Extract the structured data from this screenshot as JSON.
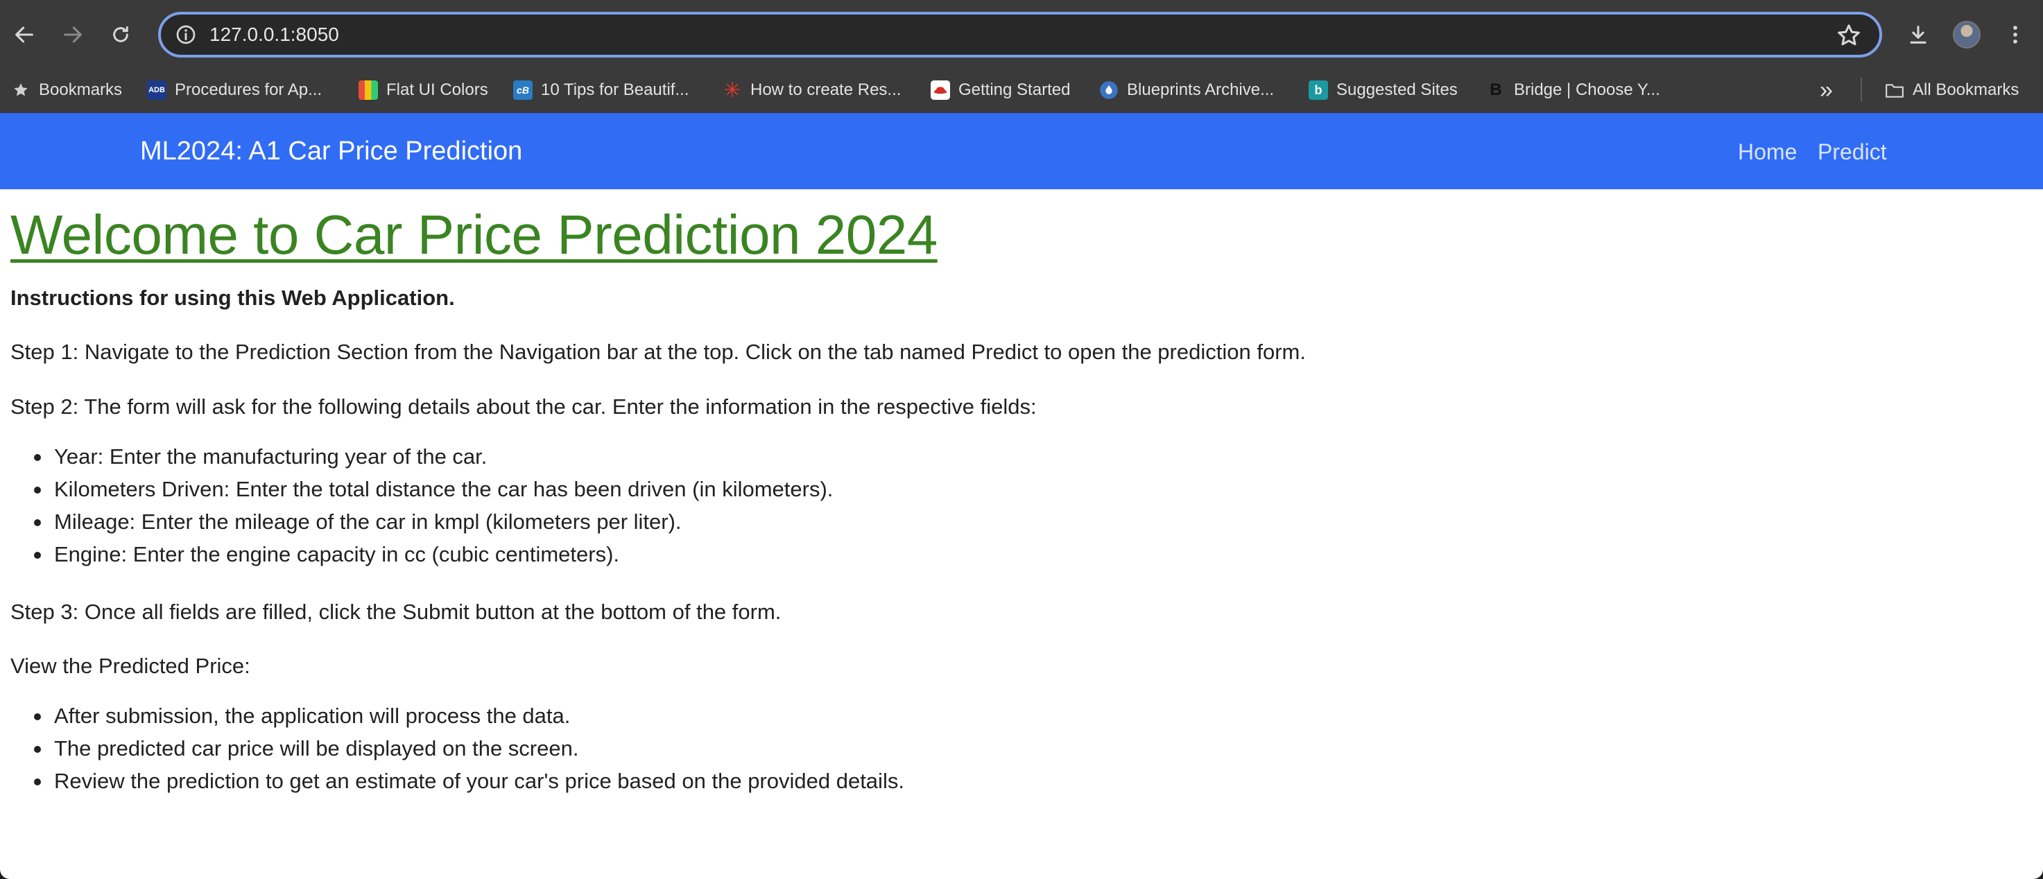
{
  "browser": {
    "url": "127.0.0.1:8050",
    "bookmarks": [
      {
        "label": "Bookmarks",
        "icon": "star-icon"
      },
      {
        "label": "Procedures for Ap...",
        "icon": "adb-icon",
        "badge": "ADB"
      },
      {
        "label": "Flat UI Colors",
        "icon": "flat-ui-colors-icon"
      },
      {
        "label": "10 Tips for Beautif...",
        "icon": "cb-icon",
        "badge": "cB"
      },
      {
        "label": "How to create Res...",
        "icon": "asterisk-icon"
      },
      {
        "label": "Getting Started",
        "icon": "redhat-icon"
      },
      {
        "label": "Blueprints Archive...",
        "icon": "drop-icon"
      },
      {
        "label": "Suggested Sites",
        "icon": "bing-icon",
        "badge": "b"
      },
      {
        "label": "Bridge | Choose Y...",
        "icon": "bridge-icon",
        "badge": "B"
      }
    ],
    "overflow_label": "»",
    "all_bookmarks_label": "All Bookmarks"
  },
  "navbar": {
    "brand": "ML2024: A1 Car Price Prediction",
    "links": [
      "Home",
      "Predict"
    ],
    "bg_color": "#316cf4"
  },
  "main": {
    "title": "Welcome to Car Price Prediction 2024",
    "title_color": "#3a8422",
    "instructions_heading": "Instructions for using this Web Application.",
    "step1": "Step 1: Navigate to the Prediction Section from the Navigation bar at the top. Click on the tab named Predict to open the prediction form.",
    "step2": "Step 2: The form will ask for the following details about the car. Enter the information in the respective fields:",
    "fields": [
      "Year: Enter the manufacturing year of the car.",
      "Kilometers Driven: Enter the total distance the car has been driven (in kilometers).",
      "Mileage: Enter the mileage of the car in kmpl (kilometers per liter).",
      "Engine: Enter the engine capacity in cc (cubic centimeters)."
    ],
    "step3": "Step 3: Once all fields are filled, click the Submit button at the bottom of the form.",
    "view_heading": "View the Predicted Price:",
    "results": [
      "After submission, the application will process the data.",
      "The predicted car price will be displayed on the screen.",
      "Review the prediction to get an estimate of your car's price based on the provided details."
    ]
  }
}
